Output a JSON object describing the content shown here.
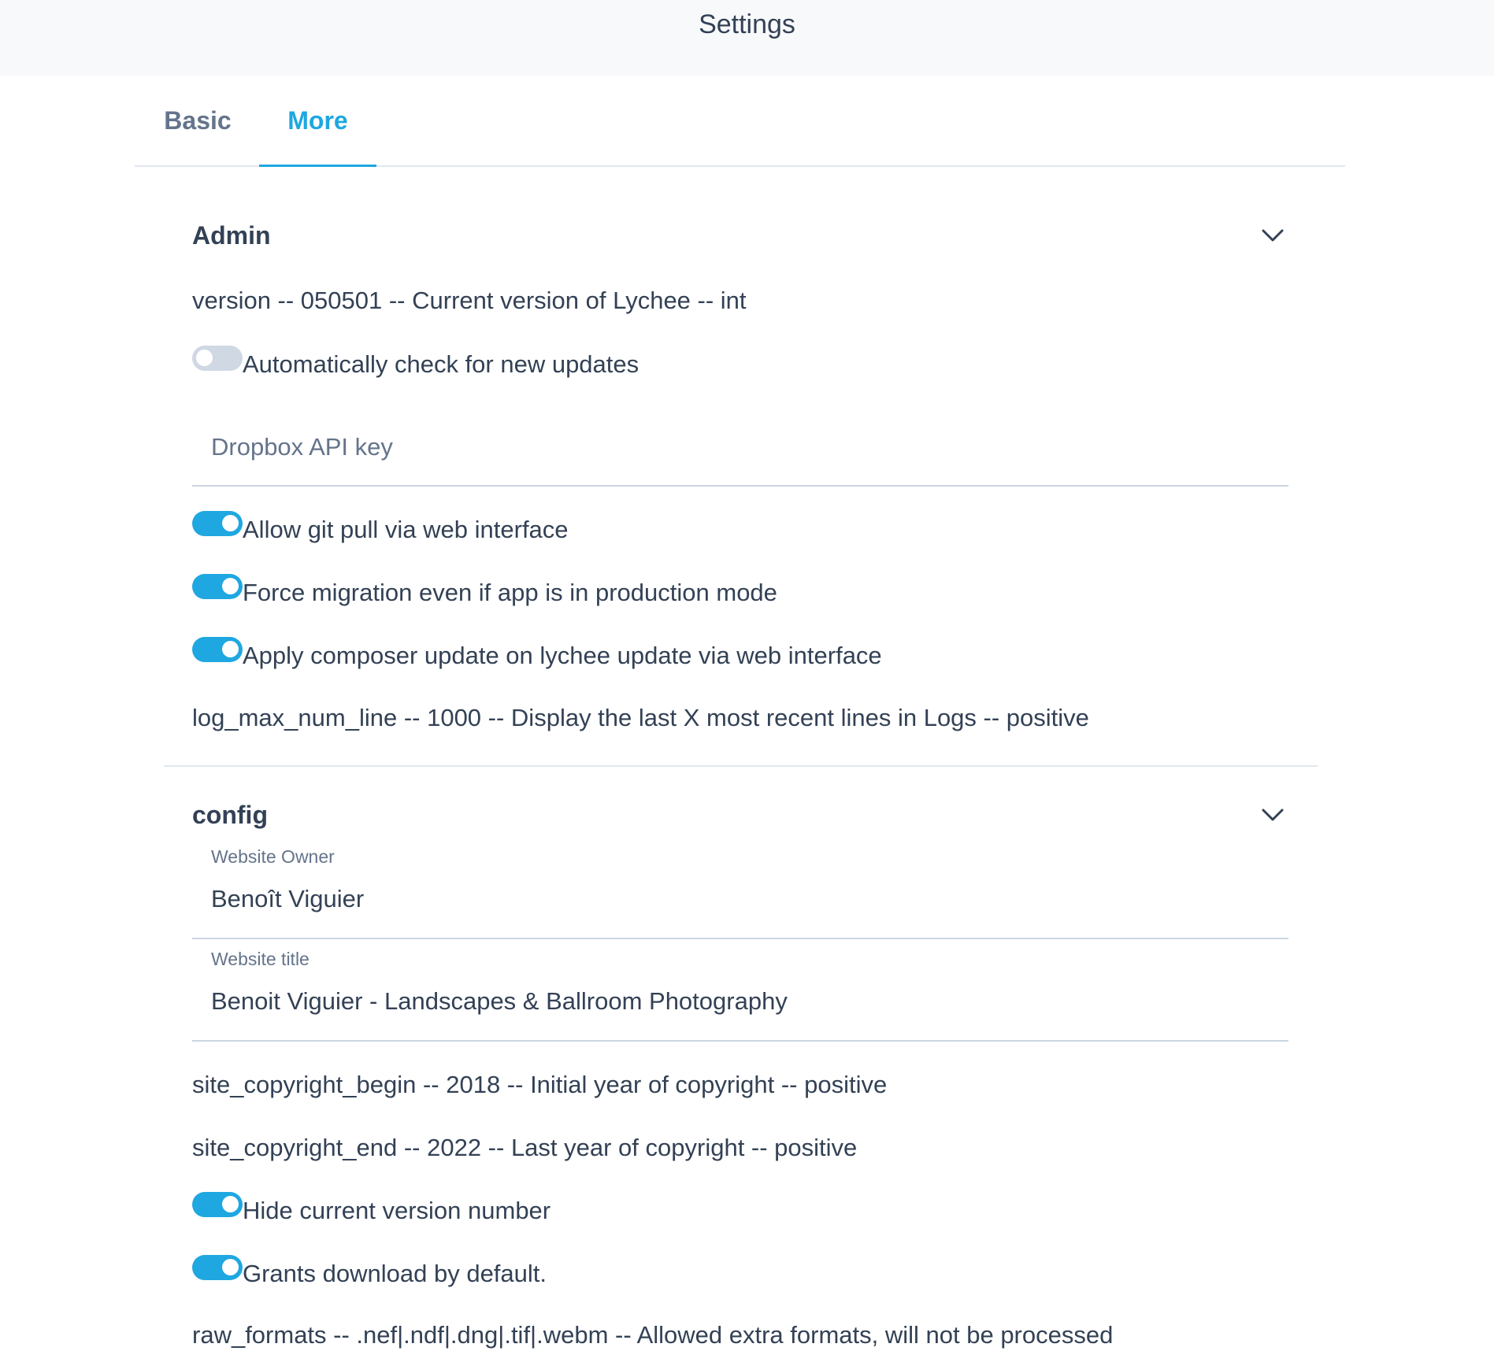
{
  "header": {
    "title": "Settings"
  },
  "tabs": [
    {
      "label": "Basic",
      "active": false
    },
    {
      "label": "More",
      "active": true
    }
  ],
  "sections": {
    "admin": {
      "title": "Admin",
      "version_text": "version -- 050501 -- Current version of Lychee -- int",
      "auto_update": {
        "label": "Automatically check for new updates",
        "enabled": false
      },
      "dropbox": {
        "placeholder": "Dropbox API key",
        "value": ""
      },
      "git_pull": {
        "label": "Allow git pull via web interface",
        "enabled": true
      },
      "force_migration": {
        "label": "Force migration even if app is in production mode",
        "enabled": true
      },
      "composer_update": {
        "label": "Apply composer update on lychee update via web interface",
        "enabled": true
      },
      "log_max_text": "log_max_num_line -- 1000 -- Display the last X most recent lines in Logs -- positive"
    },
    "config": {
      "title": "config",
      "website_owner": {
        "label": "Website Owner",
        "value": "Benoît Viguier"
      },
      "website_title": {
        "label": "Website title",
        "value": "Benoit Viguier - Landscapes & Ballroom Photography"
      },
      "copyright_begin_text": "site_copyright_begin -- 2018 -- Initial year of copyright -- positive",
      "copyright_end_text": "site_copyright_end -- 2022 -- Last year of copyright -- positive",
      "hide_version": {
        "label": "Hide current version number",
        "enabled": true
      },
      "grants_download": {
        "label": "Grants download by default.",
        "enabled": true
      },
      "raw_formats_text": "raw_formats -- .nef|.ndf|.dng|.tif|.webm -- Allowed extra formats, will not be processed"
    }
  },
  "icons": {
    "chevron": "chevron-down-icon"
  },
  "colors": {
    "accent": "#1ea7e1",
    "toggle_off": "#cfd8e3",
    "text": "#334155",
    "muted": "#64748b",
    "header_bg": "#f8f9fb"
  }
}
